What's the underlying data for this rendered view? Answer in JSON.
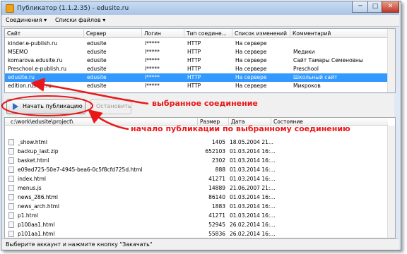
{
  "window": {
    "title": "Публикатор (1.1.2.35) - edusite.ru",
    "controls": {
      "minimize": "─",
      "maximize": "□",
      "close": "✕"
    }
  },
  "menu": [
    {
      "label": "Соединения ▾"
    },
    {
      "label": "Списки файлов ▾"
    }
  ],
  "connections": {
    "columns": [
      "Сайт",
      "Сервер",
      "Логин",
      "Тип соедине...",
      "Список изменений",
      "Комментарий"
    ],
    "rows": [
      [
        "kinder.e-publish.ru",
        "edusite",
        "l*****",
        "HTTP",
        "На сервере",
        ""
      ],
      [
        "MSEMO",
        "edusite",
        "l*****",
        "HTTP",
        "На сервере",
        "Медики"
      ],
      [
        "komarova.edusite.ru",
        "edusite",
        "l*****",
        "HTTP",
        "На сервере",
        "Сайт Тамары Семеновны"
      ],
      [
        "Preschool.e-publish.ru",
        "edusite",
        "l*****",
        "HTTP",
        "На сервере",
        "Preschool"
      ],
      [
        "edusite.ru",
        "edusite",
        "l*****",
        "HTTP",
        "На сервере",
        "Школьный сайт"
      ],
      [
        "edition.rusobr.ru",
        "edusite",
        "l*****",
        "HTTP",
        "На сервере",
        "Микроков"
      ]
    ],
    "selected_index": 4
  },
  "toolbar": {
    "start_label": "Начать публикацию",
    "stop_label": "Остановить"
  },
  "files": {
    "path": "c:\\work\\edusite\\project\\",
    "columns": [
      "Размер",
      "Дата",
      "Состояние"
    ],
    "rows": [
      {
        "name": "_show.html",
        "size": "1405",
        "date": "18.05.2004 21..."
      },
      {
        "name": "backup_last.zip",
        "size": "652103",
        "date": "01.03.2014 16:..."
      },
      {
        "name": "basket.html",
        "size": "2302",
        "date": "01.03.2014 16:..."
      },
      {
        "name": "e09ad725-50e7-4945-bea6-0c5f8cfd725d.html",
        "size": "888",
        "date": "01.03.2014 16:..."
      },
      {
        "name": "index.html",
        "size": "41271",
        "date": "01.03.2014 16:..."
      },
      {
        "name": "menus.js",
        "size": "14889",
        "date": "21.06.2007 21:..."
      },
      {
        "name": "news_286.html",
        "size": "86140",
        "date": "01.03.2014 16:..."
      },
      {
        "name": "news_arch.html",
        "size": "1883",
        "date": "01.03.2014 16:..."
      },
      {
        "name": "p1.html",
        "size": "41271",
        "date": "01.03.2014 16:..."
      },
      {
        "name": "p100aa1.html",
        "size": "52945",
        "date": "26.02.2014 16:..."
      },
      {
        "name": "p101aa1.html",
        "size": "55836",
        "date": "26.02.2014 16:..."
      }
    ]
  },
  "status": {
    "text": "Выберите аккаунт и нажмите кнопку \"Закачать\""
  },
  "annotations": {
    "selected_connection": "выбранное соединение",
    "start_publication": "начало публикации по выбранному соединению",
    "color": "#e8181a"
  }
}
